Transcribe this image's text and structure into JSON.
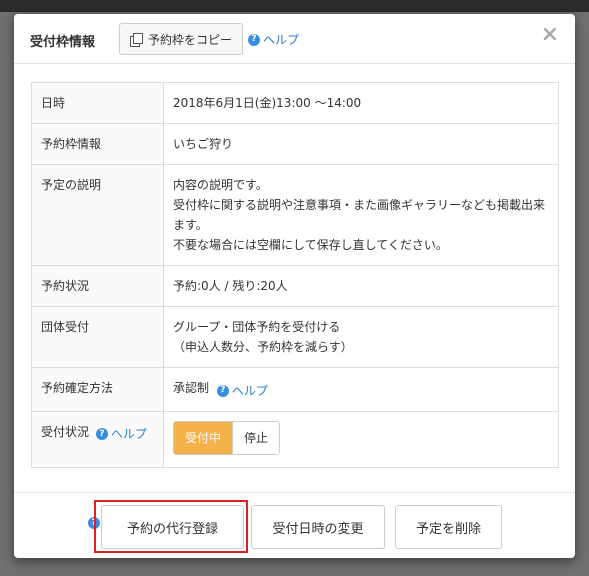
{
  "header": {
    "title": "受付枠情報",
    "copy_button": "予約枠をコピー",
    "help_label": "ヘルプ",
    "close_symbol": "×"
  },
  "rows": [
    {
      "label": "日時",
      "lines": [
        "2018年6月1日(金)13:00 ～14:00"
      ]
    },
    {
      "label": "予約枠情報",
      "lines": [
        "いちご狩り"
      ]
    },
    {
      "label": "予定の説明",
      "lines": [
        "内容の説明です。",
        "受付枠に関する説明や注意事項・また画像ギャラリーなども掲載出来",
        "ます。",
        "不要な場合には空欄にして保存し直してください。"
      ]
    },
    {
      "label": "予約状況",
      "lines": [
        "予約:0人 / 残り:20人"
      ]
    },
    {
      "label": "団体受付",
      "lines": [
        "グループ・団体予約を受付ける",
        "（申込人数分、予約枠を減らす）"
      ]
    }
  ],
  "confirm_row": {
    "label": "予約確定方法",
    "value": "承認制",
    "help": "ヘルプ"
  },
  "status_row": {
    "label": "受付状況",
    "help": "ヘルプ",
    "active": "受付中",
    "inactive": "停止"
  },
  "footer": {
    "proxy_button": "予約の代行登録",
    "change_button": "受付日時の変更",
    "delete_button": "予定を削除"
  },
  "icons": {
    "help": "?"
  },
  "colors": {
    "accent": "#f5b14a",
    "link": "#2a7fd4",
    "highlight": "#e02020"
  }
}
